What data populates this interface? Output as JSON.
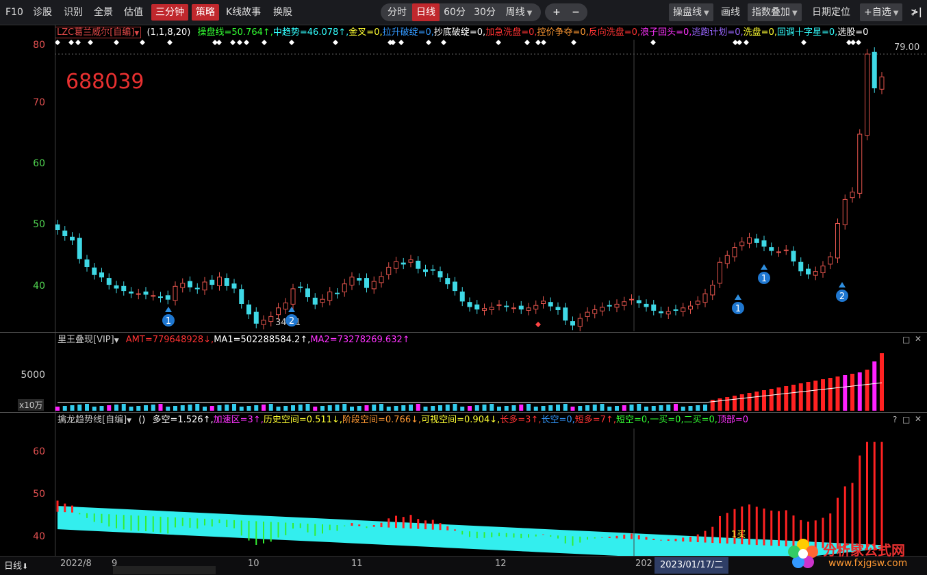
{
  "toolbar": {
    "items": [
      "F10",
      "诊股",
      "识别",
      "全景",
      "估值",
      "三分钟",
      "策略",
      "K线故事",
      "换股"
    ],
    "periods": [
      "分时",
      "日线",
      "60分",
      "30分",
      "周线"
    ],
    "plus": "+",
    "minus": "−",
    "drop1": "操盘线",
    "draw": "画线",
    "drop2": "指数叠加",
    "datepos": "日期定位",
    "watch": "+自选",
    "end": "≯|"
  },
  "main_panel": {
    "indicator_name": "LZC葛兰威尔[自编]",
    "params": "(1,1,8,20)",
    "ticker": "688039",
    "high_label": "79.00",
    "low_label": "34.21",
    "yticks": [
      "80",
      "70",
      "60",
      "50",
      "40"
    ],
    "fields": [
      {
        "text": "操盘线=50.764",
        "arrow": "↑",
        "color": "#33ff33"
      },
      {
        "text": "中趋势=46.078",
        "arrow": "↑",
        "color": "#33ffff"
      },
      {
        "text": "金叉=0",
        "color": "#ffff33"
      },
      {
        "text": "拉升破绽=0",
        "color": "#3399ff"
      },
      {
        "text": "抄底破绽=0",
        "color": "#ffffff"
      },
      {
        "text": "加急洗盘=0",
        "color": "#ff3333"
      },
      {
        "text": "控价争夺=0",
        "color": "#ff9933"
      },
      {
        "text": "反向洗盘=0",
        "color": "#ff3333"
      },
      {
        "text": "浪子回头=0",
        "color": "#ff33ff"
      },
      {
        "text": "逃跑计划=0",
        "color": "#9966ff"
      },
      {
        "text": "洗盘=0",
        "color": "#ffff33"
      },
      {
        "text": "回调十字星=0",
        "color": "#33ffff"
      },
      {
        "text": "选股=0",
        "color": "#ffffff"
      }
    ],
    "markers": [
      {
        "label": "1"
      },
      {
        "label": "2"
      },
      {
        "label": "1"
      },
      {
        "label": "1"
      },
      {
        "label": "2"
      }
    ]
  },
  "volume_panel": {
    "indicator_name": "里王叠现[VIP]",
    "ytick": "5000",
    "unit": "x10万",
    "fields": [
      {
        "text": "AMT=779648928",
        "arrow": "↓",
        "color": "#ff3333"
      },
      {
        "text": "MA1=502288584.2",
        "arrow": "↑",
        "color": "#ffffff"
      },
      {
        "text": "MA2=73278269.632",
        "arrow": "↑",
        "color": "#ff33ff"
      }
    ]
  },
  "trend_panel": {
    "indicator_name": "擒龙趋势线[自编]",
    "params": "()",
    "yticks": [
      "60",
      "50",
      "40"
    ],
    "mark_label": "1买",
    "fields": [
      {
        "text": "多空=1.526",
        "arrow": "↑",
        "color": "#ffffff"
      },
      {
        "text": "加速区=3",
        "arrow": "↑",
        "color": "#ff33ff"
      },
      {
        "text": "历史空间=0.511",
        "arrow": "↓",
        "color": "#ffff33"
      },
      {
        "text": "阶段空间=0.766",
        "arrow": "↓",
        "color": "#ff9933"
      },
      {
        "text": "可视空间=0.904",
        "arrow": "↓",
        "color": "#ffff33"
      },
      {
        "text": "长多=3",
        "arrow": "↑",
        "color": "#ff3333"
      },
      {
        "text": "长空=0",
        "color": "#3399ff"
      },
      {
        "text": "短多=7",
        "arrow": "↑",
        "color": "#ff3333"
      },
      {
        "text": "短空=0",
        "color": "#33ff33"
      },
      {
        "text": "一买=0",
        "color": "#33ff33"
      },
      {
        "text": "二买=0",
        "color": "#33ff33"
      },
      {
        "text": "顶部=0",
        "color": "#ff33ff"
      }
    ]
  },
  "xaxis": {
    "labels": [
      "2022/8",
      "9",
      "10",
      "11",
      "12",
      "202"
    ],
    "cursor_date": "2023/01/17/二"
  },
  "footer": {
    "tab": "日线",
    "watermark": "分析家公式网",
    "watermark_url": "www.fxjgsw.com"
  },
  "chart_data": {
    "type": "candlestick",
    "ylim": [
      34,
      80
    ],
    "close": [
      50.5,
      49.5,
      48.8,
      45.8,
      44.5,
      43.2,
      42.8,
      41.6,
      41.0,
      40.6,
      40.2,
      40.1,
      40.0,
      39.8,
      39.5,
      39.2,
      41.3,
      41.8,
      41.2,
      40.9,
      42.0,
      41.6,
      42.8,
      41.4,
      41.0,
      38.5,
      36.8,
      35.3,
      35.8,
      36.4,
      37.8,
      38.6,
      40.9,
      41.1,
      39.6,
      38.4,
      39.2,
      40.4,
      40.1,
      41.7,
      42.8,
      42.3,
      41.1,
      42.1,
      42.9,
      44.4,
      45.3,
      44.9,
      45.6,
      44.2,
      43.7,
      43.9,
      42.8,
      41.7,
      40.6,
      38.9,
      38.0,
      37.6,
      37.7,
      37.9,
      38.3,
      38.0,
      37.8,
      37.6,
      37.8,
      38.2,
      38.9,
      38.1,
      37.5,
      35.8,
      35.0,
      36.1,
      37.1,
      37.5,
      37.9,
      38.1,
      38.4,
      38.8,
      39.2,
      38.6,
      38.0,
      37.4,
      37.0,
      37.2,
      37.4,
      37.8,
      38.1,
      38.9,
      40.1,
      41.5,
      45.2,
      46.3,
      47.6,
      48.5,
      49.2,
      48.4,
      47.8,
      47.1,
      46.9,
      47.2,
      45.4,
      43.8,
      43.3,
      43.7,
      44.6,
      46.1,
      51.5,
      55.4,
      56.6,
      66.0,
      79.0,
      73.5,
      75.3
    ]
  }
}
